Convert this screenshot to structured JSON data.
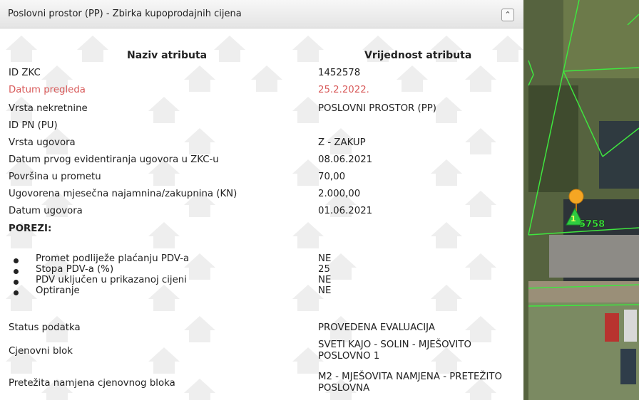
{
  "panel": {
    "title": "Poslovni prostor (PP) - Zbirka kupoprodajnih cijena",
    "collapse_glyph": "⌃",
    "col_name_header": "Naziv atributa",
    "col_value_header": "Vrijednost atributa",
    "rows": [
      {
        "label": "ID ZKC",
        "value": "1452578"
      },
      {
        "label": "Datum pregleda",
        "value": "25.2.2022."
      },
      {
        "label": "Vrsta nekretnine",
        "value": "POSLOVNI PROSTOR (PP)"
      },
      {
        "label": "ID PN (PU)",
        "value": ""
      },
      {
        "label": "Vrsta ugovora",
        "value": "Z - ZAKUP"
      },
      {
        "label": "Datum prvog evidentiranja ugovora u ZKC-u",
        "value": "08.06.2021"
      },
      {
        "label": "Površina u prometu",
        "value": "70,00"
      },
      {
        "label": "Ugovorena mjesečna najamnina/zakupnina (KN)",
        "value": "2.000,00"
      },
      {
        "label": "Datum ugovora",
        "value": "01.06.2021"
      }
    ],
    "taxes_header": "POREZI:",
    "tax_items": [
      {
        "label": "Promet podliježe plaćanju PDV-a",
        "value": "NE"
      },
      {
        "label": "Stopa PDV-a (%)",
        "value": "25"
      },
      {
        "label": "PDV uključen u prikazanoj cijeni",
        "value": "NE"
      },
      {
        "label": "Optiranje",
        "value": "NE"
      }
    ],
    "footer_rows": [
      {
        "label": "Status podatka",
        "value": "PROVEDENA EVALUACIJA"
      },
      {
        "label": "Cjenovni blok",
        "value": "SVETI KAJO - SOLIN - MJEŠOVITO POSLOVNO 1"
      },
      {
        "label": "Pretežita namjena cjenovnog bloka",
        "value": "M2 - MJEŠOVITA NAMJENA - PRETEŽITO POSLOVNA"
      }
    ]
  },
  "map": {
    "marker_number": "1",
    "parcel_label": "5758"
  },
  "colors": {
    "highlight_red": "#d85a5a",
    "map_line_green": "#3fe63f",
    "marker_orange": "#f5a623"
  }
}
